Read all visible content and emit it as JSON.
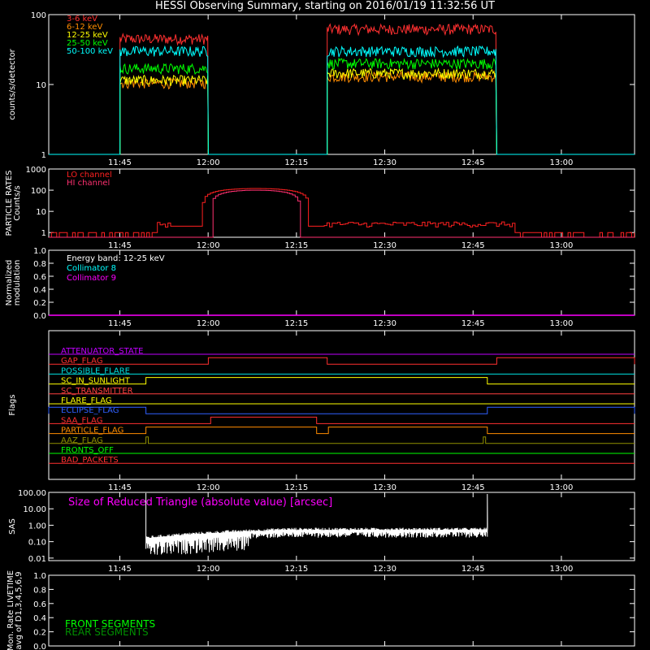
{
  "title": "HESSI Observing Summary, starting on 2016/01/19 11:32:56 UT",
  "time_ticks": [
    "11:45",
    "12:00",
    "12:15",
    "12:30",
    "12:45",
    "13:00"
  ],
  "time_ticks_minutes": [
    12.07,
    27.07,
    42.07,
    57.07,
    72.07,
    87.07
  ],
  "time_range_minutes": [
    0,
    99.5
  ],
  "chart_data": [
    {
      "type": "line",
      "id": "count-rates",
      "ylabel": "counts/s/detector",
      "yscale": "log",
      "ylim": [
        1,
        100
      ],
      "yticks": [
        "1",
        "10",
        "100"
      ],
      "legend_placement": "top-left",
      "data_intervals_minutes": [
        [
          12.1,
          27.1
        ],
        [
          47.3,
          76.1
        ]
      ],
      "series": [
        {
          "name": "3-6 keV",
          "color": "#ff3030",
          "values_interval1": 45,
          "values_interval2": 62
        },
        {
          "name": "6-12 keV",
          "color": "#ff8c00",
          "values_interval1": 10.5,
          "values_interval2": 13
        },
        {
          "name": "12-25 keV",
          "color": "#ffff00",
          "values_interval1": 11.5,
          "values_interval2": 14.5
        },
        {
          "name": "25-50 keV",
          "color": "#00ff00",
          "values_interval1": 17,
          "values_interval2": 20
        },
        {
          "name": "50-100 keV",
          "color": "#00ffff",
          "values_interval1": 30,
          "values_interval2": 30
        }
      ]
    },
    {
      "type": "line",
      "id": "particle-rates",
      "ylabel": "PARTICLE RATES Counts/s",
      "yscale": "log",
      "ylim": [
        0.6,
        1000
      ],
      "yticks": [
        "1",
        "10",
        "100",
        "1000"
      ],
      "series": [
        {
          "name": "LO channel",
          "color": "#ff2020"
        },
        {
          "name": "HI channel",
          "color": "#ff3070"
        }
      ],
      "saa_peak_minutes": [
        27.5,
        42.5
      ],
      "saa_peak_value": 100
    },
    {
      "type": "line",
      "id": "modulation",
      "ylabel": "Normalized modulation",
      "ylim": [
        0,
        1
      ],
      "yticks": [
        "0.0",
        "0.2",
        "0.4",
        "0.6",
        "0.8",
        "1.0"
      ],
      "annotation": "Energy band: 12-25 keV",
      "series": [
        {
          "name": "Collimator 8",
          "color": "#00ffff"
        },
        {
          "name": "Collimator 9",
          "color": "#ff00ff"
        }
      ]
    },
    {
      "type": "line",
      "id": "flags",
      "ylabel": "Flags",
      "flags": [
        {
          "name": "ATTENUATOR_STATE",
          "color": "#c000ff",
          "on": []
        },
        {
          "name": "GAP_FLAG",
          "color": "#ff3030",
          "on": [
            [
              27.1,
              47.3
            ],
            [
              76.1,
              99.5
            ]
          ]
        },
        {
          "name": "POSSIBLE_FLARE",
          "color": "#00e0e0",
          "on": []
        },
        {
          "name": "SC_IN_SUNLIGHT",
          "color": "#ffff00",
          "on": [
            [
              16.5,
              74.5
            ]
          ]
        },
        {
          "name": "SC_TRANSMITTER",
          "color": "#ff4040",
          "on": []
        },
        {
          "name": "FLARE_FLAG",
          "color": "#ffff00",
          "on": []
        },
        {
          "name": "ECLIPSE_FLAG",
          "color": "#3060ff",
          "on": [
            [
              0,
              16.5
            ],
            [
              74.5,
              99.5
            ]
          ]
        },
        {
          "name": "SAA_FLAG",
          "color": "#ff3030",
          "on": [
            [
              27.5,
              45.5
            ]
          ]
        },
        {
          "name": "PARTICLE_FLAG",
          "color": "#ff8c00",
          "on": [
            [
              16.5,
              45.5
            ],
            [
              47.5,
              74.5
            ]
          ]
        },
        {
          "name": "AAZ_FLAG",
          "color": "#909000",
          "on": [
            [
              16.5,
              16.9
            ],
            [
              73.8,
              74.2
            ]
          ]
        },
        {
          "name": "FRONTS_OFF",
          "color": "#00ff00",
          "on": []
        },
        {
          "name": "BAD_PACKETS",
          "color": "#ff3030",
          "on": []
        }
      ]
    },
    {
      "type": "line",
      "id": "sas",
      "ylabel": "SAS",
      "yscale": "log",
      "ylim": [
        0.007,
        100
      ],
      "yticks": [
        "0.01",
        "0.10",
        "1.00",
        "10.00",
        "100.00"
      ],
      "annotation": "Size of Reduced Triangle (absolute value) [arcsec]",
      "annotation_color": "#ff00ff",
      "data_interval_minutes": [
        16.5,
        74.5
      ],
      "typical_value": 0.5
    },
    {
      "type": "line",
      "id": "livetime",
      "ylabel": "Mon. Rate LIVETIME avg of D1,3,4,5,6,9",
      "ylim": [
        0,
        1
      ],
      "yticks": [
        "0.0",
        "0.2",
        "0.4",
        "0.6",
        "0.8",
        "1.0"
      ],
      "series": [
        {
          "name": "FRONT SEGMENTS",
          "color": "#00ff00"
        },
        {
          "name": "REAR SEGMENTS",
          "color": "#009000"
        }
      ]
    }
  ]
}
